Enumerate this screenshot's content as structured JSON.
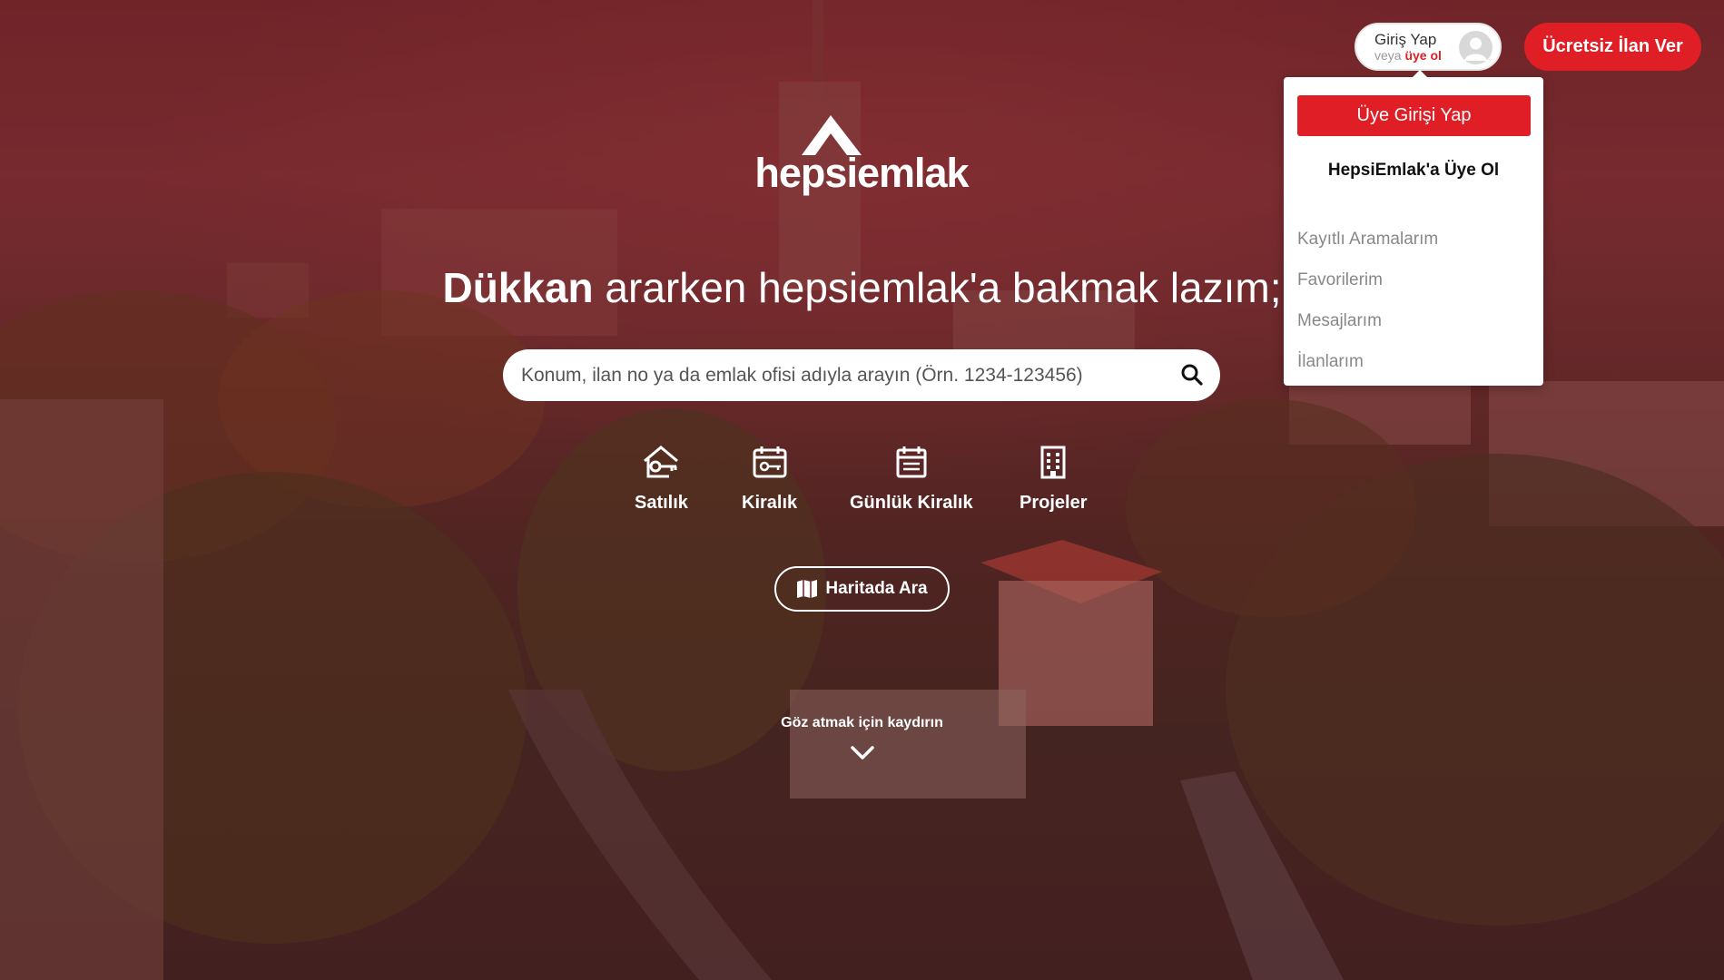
{
  "header": {
    "login_title": "Giriş Yap",
    "login_or": "veya",
    "login_signup": "üye ol",
    "free_ad_button": "Ücretsiz İlan Ver"
  },
  "dropdown": {
    "login_button": "Üye Girişi Yap",
    "signup_link": "HepsiEmlak'a Üye Ol",
    "items": [
      "Kayıtlı Aramalarım",
      "Favorilerim",
      "Mesajlarım",
      "İlanlarım"
    ]
  },
  "logo": {
    "text": "hepsiemlak"
  },
  "headline": {
    "bold": "Dükkan",
    "rest": " ararken hepsiemlak'a bakmak lazım;"
  },
  "search": {
    "placeholder": "Konum, ilan no ya da emlak ofisi adıyla arayın (Örn. 1234-123456)"
  },
  "categories": [
    {
      "label": "Satılık",
      "icon": "house-key-icon"
    },
    {
      "label": "Kiralık",
      "icon": "calendar-key-icon"
    },
    {
      "label": "Günlük Kiralık",
      "icon": "calendar-icon"
    },
    {
      "label": "Projeler",
      "icon": "building-icon"
    }
  ],
  "map_button": {
    "label": "Haritada Ara",
    "icon": "map-icon"
  },
  "scroll_hint": {
    "text": "Göz atmak için kaydırın",
    "icon": "chevron-down-icon"
  },
  "colors": {
    "brand_red": "#e01e26",
    "overlay": "#731923"
  }
}
